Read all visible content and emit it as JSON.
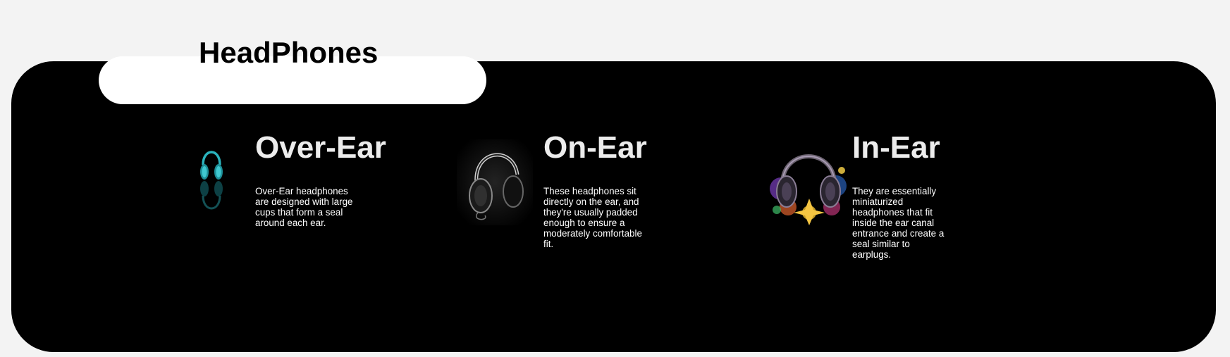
{
  "page": {
    "title": "HeadPhones"
  },
  "cards": [
    {
      "title": "Over-Ear",
      "description": "Over-Ear headphones are designed with large cups that form a seal around each ear.",
      "icon": "teal-headphones-icon"
    },
    {
      "title": "On-Ear",
      "description": "These headphones sit directly on the ear, and they're usually padded enough to ensure a moderately comfortable fit.",
      "icon": "black-headphones-icon"
    },
    {
      "title": "In-Ear",
      "description": "They are essentially miniaturized headphones that fit inside the ear canal entrance and create a seal similar to earplugs.",
      "icon": "colorful-headphones-icon"
    }
  ],
  "colors": {
    "page_background": "#f3f3f3",
    "panel_background": "#000000",
    "title_pill": "#ffffff",
    "heading_text": "#ececec",
    "body_text": "#ffffff",
    "accent_teal": "#2bb3bd"
  }
}
